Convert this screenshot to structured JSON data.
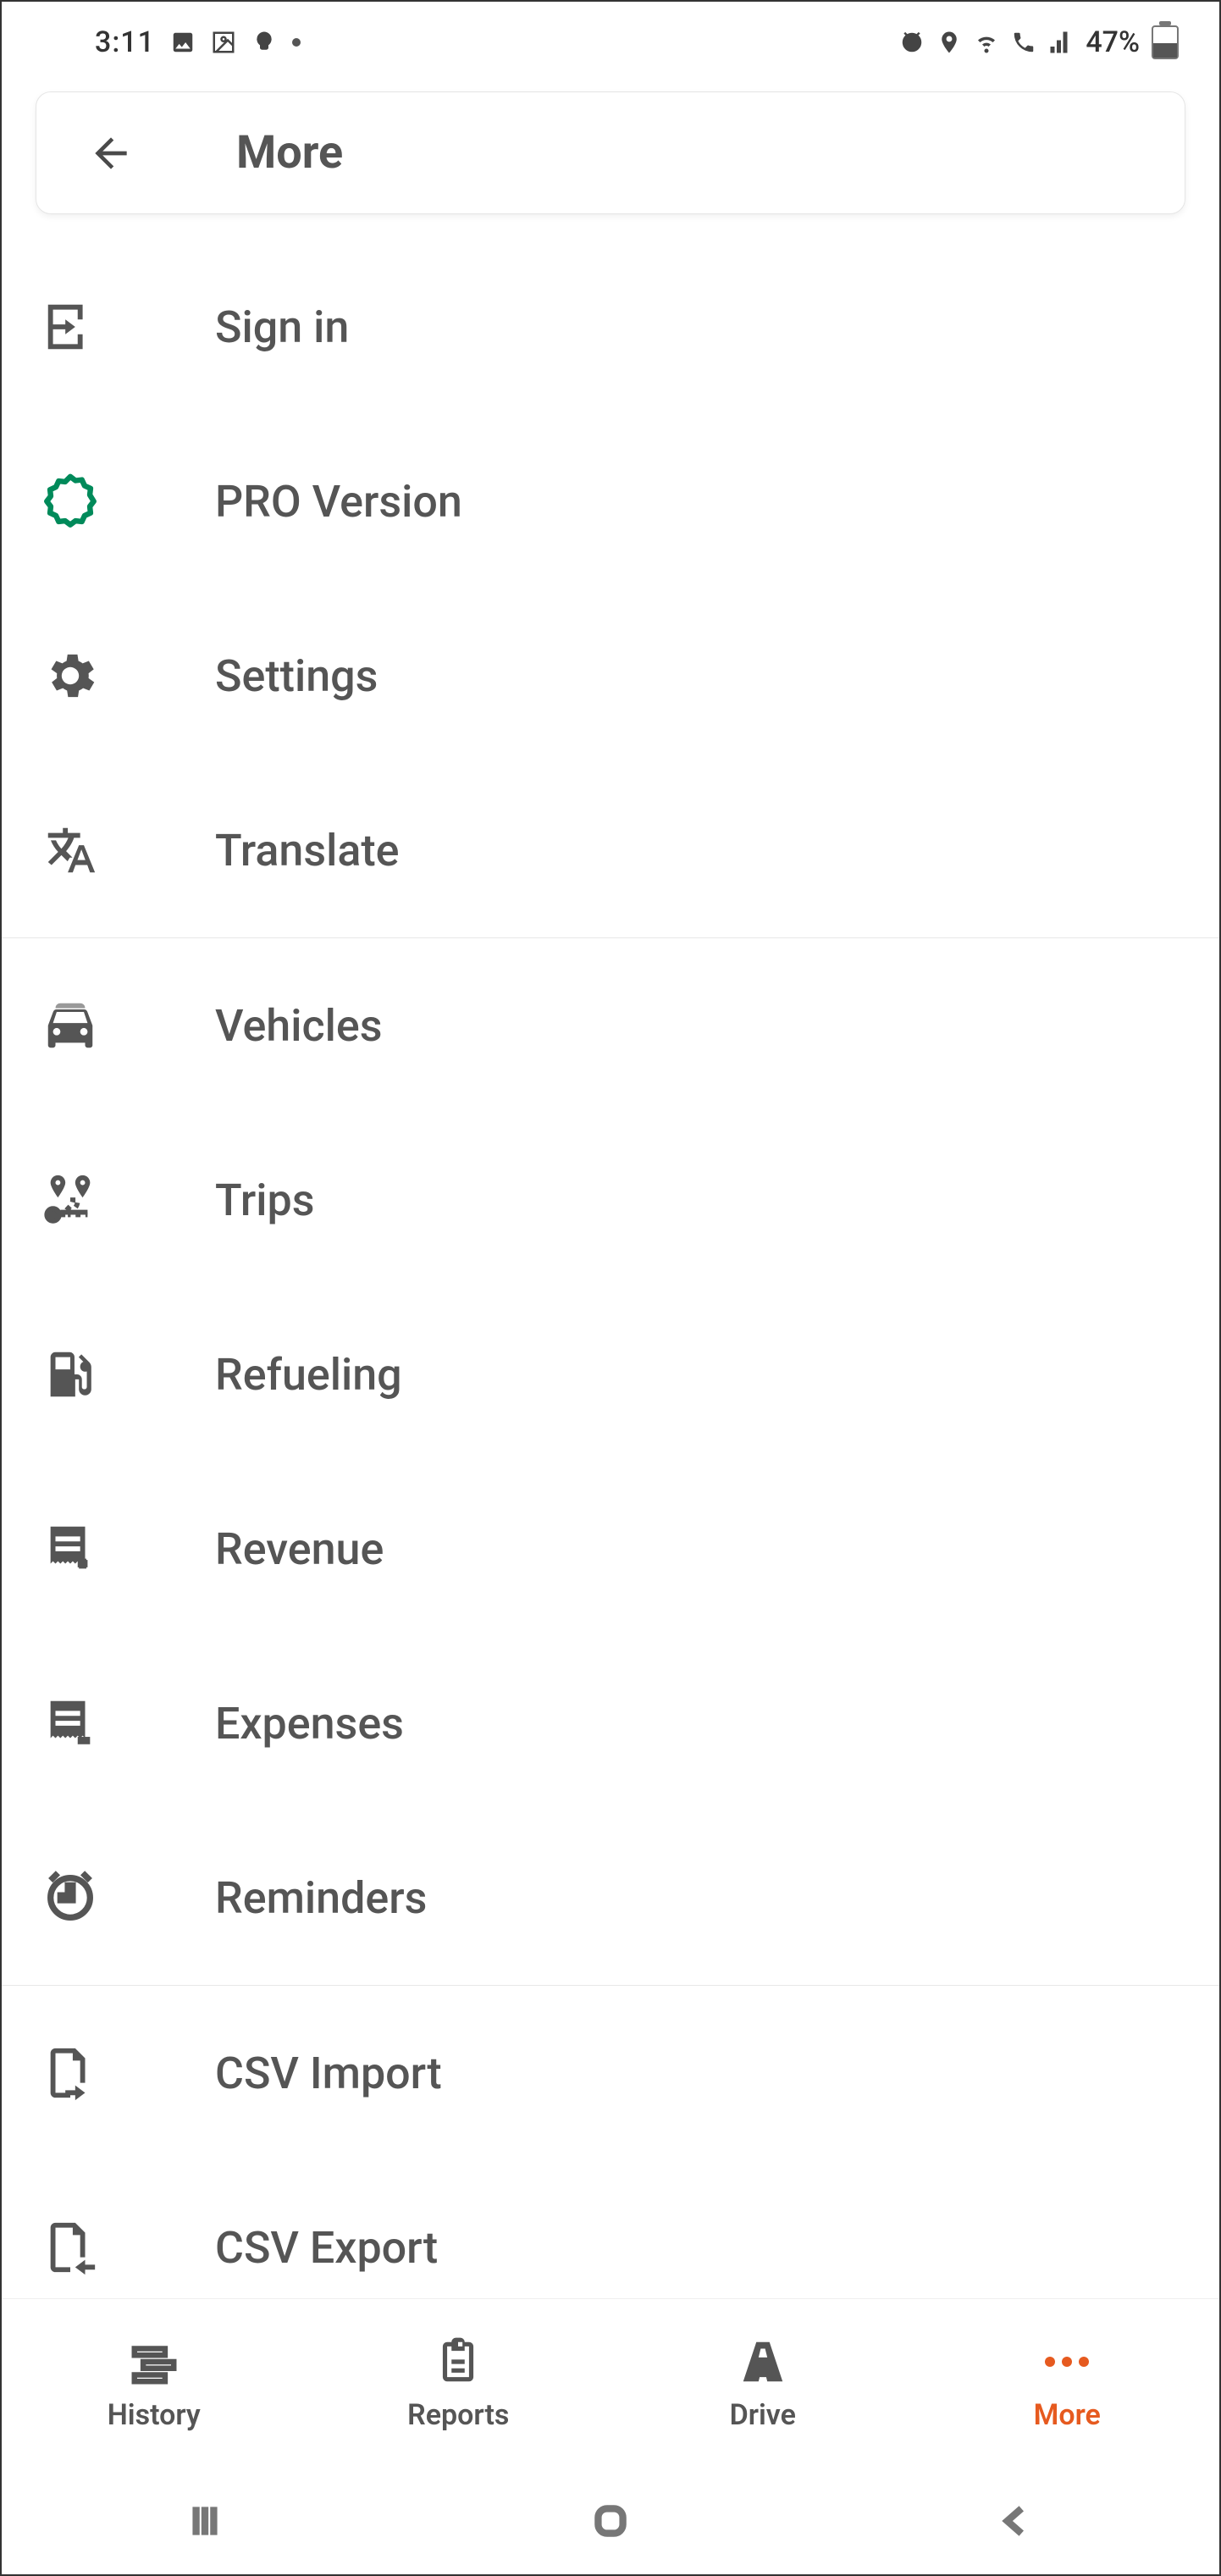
{
  "status": {
    "time": "3:11",
    "battery": "47%"
  },
  "header": {
    "title": "More"
  },
  "menu_groups": [
    [
      {
        "label": "Sign in",
        "icon": "sign-in-icon"
      },
      {
        "label": "PRO Version",
        "icon": "pro-icon"
      },
      {
        "label": "Settings",
        "icon": "settings-icon"
      },
      {
        "label": "Translate",
        "icon": "translate-icon"
      }
    ],
    [
      {
        "label": "Vehicles",
        "icon": "vehicles-icon"
      },
      {
        "label": "Trips",
        "icon": "trips-icon"
      },
      {
        "label": "Refueling",
        "icon": "refueling-icon"
      },
      {
        "label": "Revenue",
        "icon": "revenue-icon"
      },
      {
        "label": "Expenses",
        "icon": "expenses-icon"
      },
      {
        "label": "Reminders",
        "icon": "reminders-icon"
      }
    ],
    [
      {
        "label": "CSV Import",
        "icon": "csv-import-icon"
      },
      {
        "label": "CSV Export",
        "icon": "csv-export-icon"
      }
    ]
  ],
  "bottom_nav": {
    "items": [
      {
        "label": "History",
        "icon": "history-icon",
        "active": false
      },
      {
        "label": "Reports",
        "icon": "reports-icon",
        "active": false
      },
      {
        "label": "Drive",
        "icon": "drive-icon",
        "active": false
      },
      {
        "label": "More",
        "icon": "more-icon",
        "active": true
      }
    ]
  }
}
